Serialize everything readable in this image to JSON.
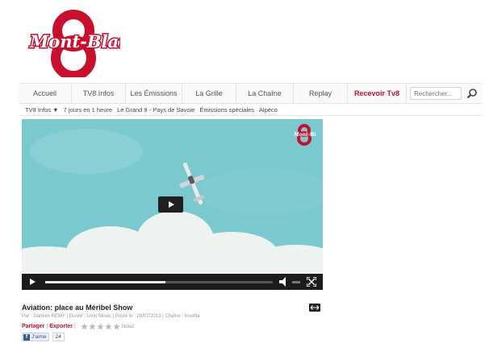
{
  "brand": {
    "logo_text": "Mont-Blanc",
    "logo_number": "8",
    "accent": "#c8102e"
  },
  "nav": {
    "items": [
      "Accueil",
      "TV8 Infos",
      "Les Émissions",
      "La Grille",
      "La Chaîne",
      "Replay",
      "Recevoir Tv8"
    ],
    "search_placeholder": "Rechercher..."
  },
  "subnav": {
    "items": [
      "TV8 Infos ▼",
      "7 jours en 1 heure",
      "Le Grand 8 - Pays de Savoie",
      "Émissions spéciales",
      "Alpéco"
    ]
  },
  "video": {
    "title": "Aviation: place au Méribel Show",
    "meta": "Par : Damien RÉMY | Durée : 1min 56sec | Posté le : 28/07/2013 | Chaîne : Insolite",
    "share_label": "Partager",
    "export_label": "Exporter",
    "rating_label": "Notez",
    "rating": 0,
    "progress": 0.0,
    "loaded": 0.53,
    "sky_color": "#79c9ce",
    "control_bar_color": "#1c1c1c"
  },
  "social": {
    "like_label": "J'aime",
    "like_count": "24",
    "fb_color": "#3b5998"
  }
}
